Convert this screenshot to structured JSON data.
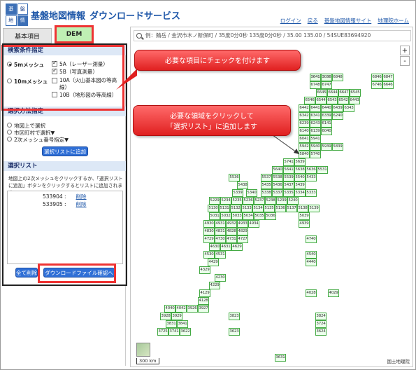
{
  "header": {
    "logo_chars": [
      "基",
      "盤",
      "地",
      "情"
    ],
    "title_main": "基盤地図情報",
    "title_sub": "ダウンロードサービス",
    "links": [
      "ログイン",
      "戻る",
      "基盤地図情報サイト",
      "地理院ホーム"
    ]
  },
  "tabs": {
    "basic": "基本項目",
    "dem": "DEM"
  },
  "search_criteria": {
    "heading": "検索条件指定",
    "mesh_5m": "5mメッシュ",
    "mesh_10m": "10mメッシュ",
    "opt_5a": "5A（レーザー測量）",
    "opt_5b": "5B（写真測量）",
    "opt_10a": "10A（火山基本図の等高線）",
    "opt_10b": "10B（地形図の等高線）"
  },
  "selection_method": {
    "heading": "選択方法指定",
    "on_map": "地図上で選択",
    "by_city": "市区町村で選択▼",
    "by_mesh": "2次メッシュ番号指定▼",
    "add_button": "選択リストに追加"
  },
  "selection_list": {
    "heading": "選択リスト",
    "hint": "地図上の2次メッシュをクリックするか、「選択リストに追加」ボタンをクリックするとリストに追加されます",
    "items": [
      {
        "code": "533904 :",
        "action": "削除"
      },
      {
        "code": "533905 :",
        "action": "削除"
      }
    ],
    "clear_all": "全て削除",
    "download_confirm": "ダウンロードファイル確認へ"
  },
  "map": {
    "search_placeholder": "例：鯖岳 / 金沢市木ノ新保町 / 35度0分0秒 135度0分0秒 / 35.00 135.00 / 54SUE83694920",
    "zoom_in": "+",
    "zoom_out": "-",
    "scale": "300 km",
    "attribution": "国土地理院",
    "tiles": [
      "6846",
      "6847",
      "6848",
      "6846",
      "6847",
      "6748",
      "6747",
      "6746",
      "6646",
      "6645",
      "6644",
      "6647",
      "6545",
      "6546",
      "6544",
      "6543",
      "6542",
      "6443",
      "6442",
      "6441",
      "6440",
      "6439",
      "6343",
      "6342",
      "6341",
      "6339",
      "6240",
      "6239",
      "6243",
      "6141",
      "6140",
      "6139",
      "6040",
      "6041",
      "5941",
      "5942",
      "5940",
      "5939",
      "5839",
      "5840",
      "5740",
      "5741",
      "5639",
      "5640",
      "5641",
      "5638",
      "5636",
      "5531",
      "5536",
      "5537",
      "5538",
      "5539",
      "5540",
      "5433",
      "5438",
      "5435",
      "5436",
      "5437",
      "5439",
      "5339",
      "5340",
      "5338",
      "5337",
      "5335",
      "5334",
      "5333",
      "5229",
      "5234",
      "5235",
      "5236",
      "5237",
      "5238",
      "5239",
      "5240",
      "5130",
      "5131",
      "5132",
      "5133",
      "5134",
      "5135",
      "5136",
      "5137",
      "5138",
      "5139",
      "5031",
      "5032",
      "5033",
      "5034",
      "5035",
      "5036",
      "5039",
      "4930",
      "4931",
      "4932",
      "4933",
      "4934",
      "4939",
      "4830",
      "4831",
      "4828",
      "4829",
      "4740",
      "4729",
      "4730",
      "4731",
      "4727",
      "4630",
      "4631",
      "4629",
      "4530",
      "4531",
      "4540",
      "4440",
      "4429",
      "4329",
      "4230",
      "4229",
      "4129",
      "4128",
      "4028",
      "4029",
      "4040",
      "4042",
      "3926",
      "3927",
      "3928",
      "3929",
      "3823",
      "3824",
      "3831",
      "3841",
      "3724",
      "3725",
      "3741",
      "3622",
      "3623",
      "3624",
      "3631",
      "3641",
      "3036"
    ]
  },
  "callouts": {
    "check_items": "必要な項目にチェックを付けます",
    "click_area": "必要な領域をクリックして\n「選択リスト」に追加します"
  },
  "colors": {
    "accent": "#1d56a8",
    "tile_border": "#44aa44",
    "callout": "#e02020",
    "dem_tab": "#bff0b4"
  }
}
